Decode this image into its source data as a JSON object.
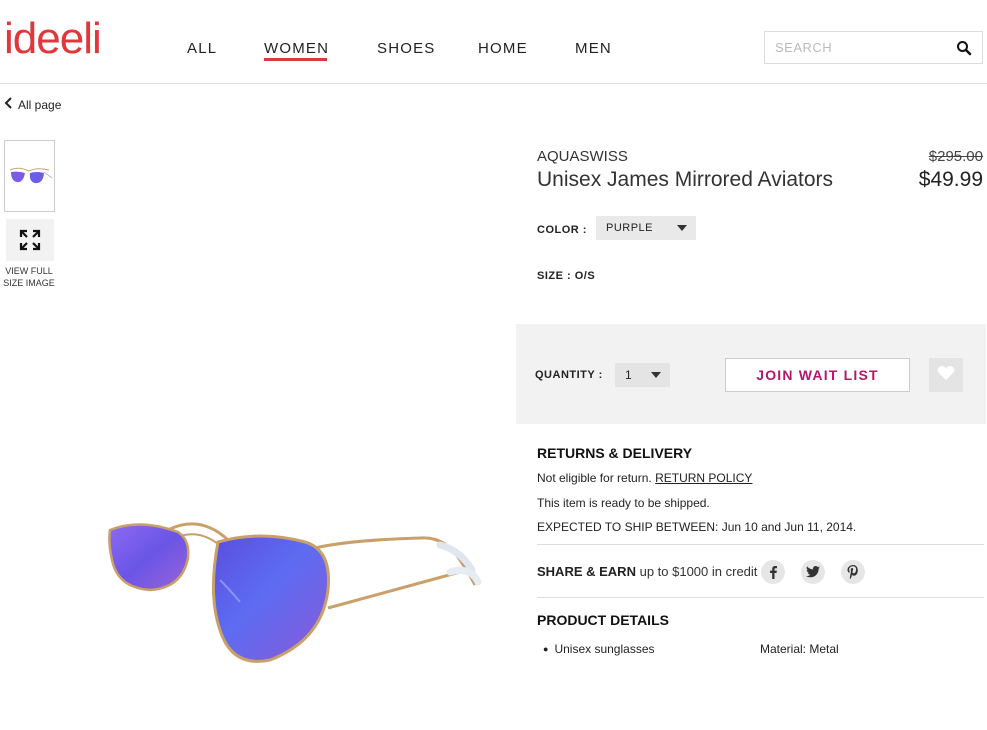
{
  "header": {
    "logo": "ideeli",
    "nav": [
      "ALL",
      "WOMEN",
      "SHOES",
      "HOME",
      "MEN"
    ],
    "active_nav": "WOMEN",
    "search_placeholder": "SEARCH"
  },
  "breadcrumb": {
    "back_label": "All page"
  },
  "gallery": {
    "view_full_label_line1": "VIEW FULL",
    "view_full_label_line2": "SIZE IMAGE"
  },
  "product": {
    "brand": "AQUASWISS",
    "name": "Unisex James Mirrored Aviators",
    "price_old": "$295.00",
    "price_new": "$49.99",
    "color_label": "COLOR :",
    "color_value": "PURPLE",
    "size_label": "SIZE : O/S",
    "quantity_label": "QUANTITY :",
    "quantity_value": "1",
    "waitlist_label": "JOIN WAIT LIST"
  },
  "returns": {
    "title": "RETURNS & DELIVERY",
    "not_eligible": "Not eligible for return.",
    "policy_link": "RETURN POLICY",
    "ready": "This item is ready to be shipped.",
    "expected": "EXPECTED TO SHIP BETWEEN: Jun 10 and Jun 11, 2014."
  },
  "share": {
    "title": "SHARE & EARN",
    "subtitle": "up to $1000 in credit"
  },
  "details": {
    "title": "PRODUCT DETAILS",
    "items": [
      "Unisex sunglasses"
    ],
    "material": "Material: Metal"
  },
  "colors": {
    "brand_red": "#e1363c",
    "accent_magenta": "#b5176b"
  }
}
